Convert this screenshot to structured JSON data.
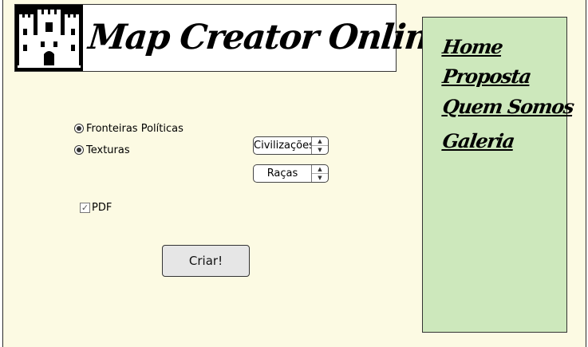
{
  "header": {
    "title": "Map Creator Online",
    "logo_icon": "castle-icon"
  },
  "options": {
    "radios": [
      {
        "label": "Fronteiras Políticas",
        "selected": true
      },
      {
        "label": "Texturas",
        "selected": true
      }
    ],
    "steppers": [
      {
        "value": "Civilizações"
      },
      {
        "value": "Raças"
      }
    ],
    "checkbox": {
      "label": "PDF",
      "checked": true
    }
  },
  "actions": {
    "create_label": "Criar!"
  },
  "nav": {
    "items": [
      {
        "label": "Home"
      },
      {
        "label": "Proposta"
      },
      {
        "label": "Quem Somos"
      },
      {
        "label": "Galeria"
      }
    ]
  },
  "colors": {
    "page_background": "#fcfae3",
    "nav_background": "#cde8bc",
    "button_background": "#e6e6e6"
  }
}
